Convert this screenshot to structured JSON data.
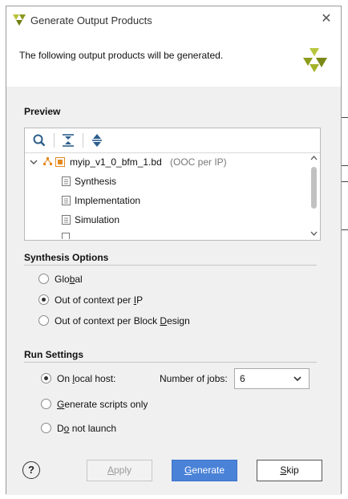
{
  "window": {
    "title": "Generate Output Products",
    "icon": "vivado-logo-icon"
  },
  "header": {
    "message": "The following output products will be generated."
  },
  "preview": {
    "heading": "Preview",
    "toolbar": [
      "search-icon",
      "collapse-all-icon",
      "expand-all-icon"
    ],
    "root": {
      "name": "myip_v1_0_bfm_1.bd",
      "suffix": "(OOC per IP)"
    },
    "children": [
      "Synthesis",
      "Implementation",
      "Simulation"
    ]
  },
  "synthesis_options": {
    "heading": "Synthesis Options",
    "options": [
      {
        "pre": "Glo",
        "mn": "b",
        "post": "al",
        "selected": false
      },
      {
        "pre": "Out of context per ",
        "mn": "I",
        "post": "P",
        "selected": true
      },
      {
        "pre": "Out of context per Block ",
        "mn": "D",
        "post": "esign",
        "selected": false
      }
    ]
  },
  "run_settings": {
    "heading": "Run Settings",
    "options": [
      {
        "pre": "On ",
        "mn": "l",
        "post": "ocal host:",
        "selected": true
      },
      {
        "pre": "",
        "mn": "G",
        "post": "enerate scripts only",
        "selected": false
      },
      {
        "pre": "D",
        "mn": "o",
        "post": " not launch",
        "selected": false
      }
    ],
    "jobs": {
      "pre": "Number of ",
      "mn": "j",
      "post": "obs:",
      "value": "6"
    }
  },
  "footer": {
    "help": "?",
    "apply": {
      "pre": "",
      "mn": "A",
      "post": "pply"
    },
    "generate": {
      "pre": "",
      "mn": "G",
      "post": "enerate"
    },
    "skip": {
      "pre": "",
      "mn": "S",
      "post": "kip"
    }
  },
  "colors": {
    "primary_button": "#4a82d8",
    "panel_bg": "#f0f0f0",
    "logo_green": "#9aaa1e"
  }
}
